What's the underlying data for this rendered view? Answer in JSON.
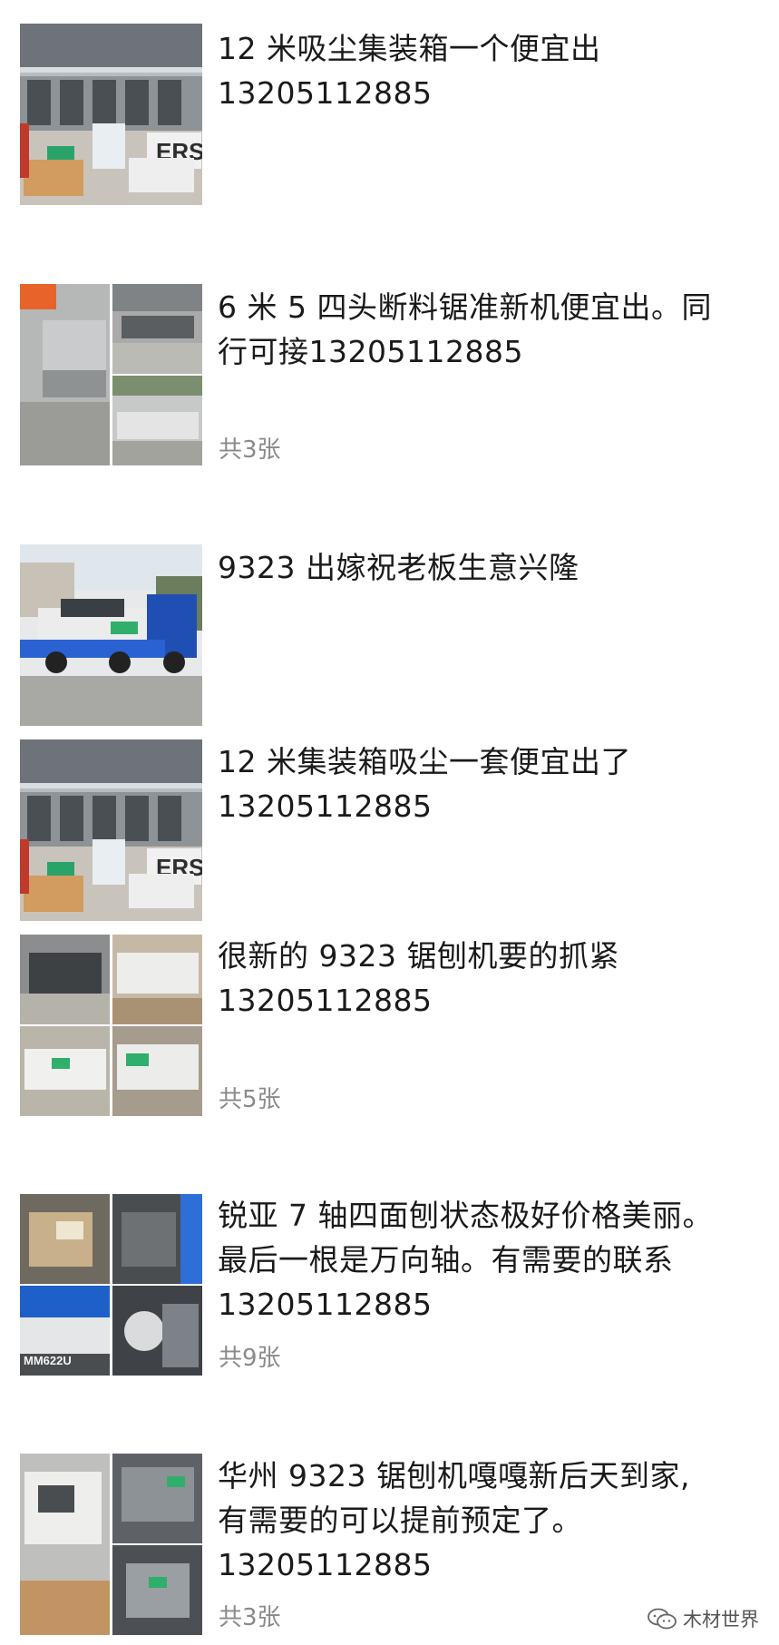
{
  "posts": [
    {
      "lines": [
        "12 米吸尘集装箱一个便宜出",
        "13205112885"
      ],
      "count": "",
      "images": [
        "container-dust-collector"
      ]
    },
    {
      "lines": [
        "6 米 5 四头断料锯准新机便宜出。同",
        "行可接13205112885"
      ],
      "count": "共3张",
      "images": [
        "cutoff-saw-1",
        "cutoff-saw-2",
        "cutoff-saw-3"
      ]
    },
    {
      "lines": [
        "9323 出嫁祝老板生意兴隆"
      ],
      "count": "",
      "images": [
        "truck-delivery"
      ]
    },
    {
      "lines": [
        "12 米集装箱吸尘一套便宜出了",
        "13205112885"
      ],
      "count": "",
      "images": [
        "container-dust-collector-2"
      ]
    },
    {
      "lines": [
        "很新的 9323 锯刨机要的抓紧",
        "13205112885"
      ],
      "count": "共5张",
      "images": [
        "saw-planer-1",
        "saw-planer-2",
        "saw-planer-3",
        "saw-planer-4"
      ]
    },
    {
      "lines": [
        "锐亚 7 轴四面刨状态极好价格美丽。",
        "最后一根是万向轴。有需要的联系",
        "13205112885"
      ],
      "count": "共9张",
      "images": [
        "moulder-1",
        "moulder-2",
        "moulder-3",
        "moulder-4"
      ],
      "image_caption": "MM622U"
    },
    {
      "lines": [
        "华州 9323 锯刨机嘎嘎新后天到家,",
        "有需要的可以提前预定了。",
        "13205112885"
      ],
      "count": "共3张",
      "images": [
        "huazhou-1",
        "huazhou-2",
        "huazhou-3"
      ]
    }
  ],
  "watermark": {
    "text": "木材世界",
    "icon": "wechat-channel-icon"
  }
}
